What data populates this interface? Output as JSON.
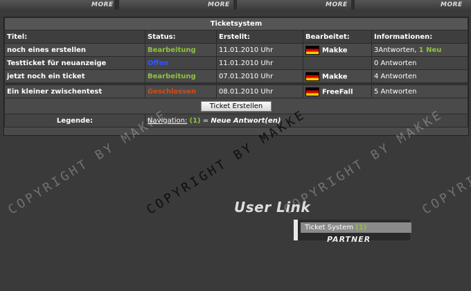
{
  "topbar": {
    "more_label": "MORE"
  },
  "table": {
    "title": "Ticketsystem",
    "headers": [
      "Titel:",
      "Status:",
      "Erstellt:",
      "Bearbeitet:",
      "Informationen:"
    ],
    "rows": [
      {
        "title": "noch eines erstellen",
        "status": "Bearbeitung",
        "created": "11.01.2010 Uhr",
        "editor": "Makke",
        "info": "3Antworten,",
        "info_new": "1 Neu"
      },
      {
        "title": "Testticket für neuanzeige",
        "status": "Offen",
        "created": "11.01.2010 Uhr",
        "editor": "",
        "info": "0 Antworten",
        "info_new": ""
      },
      {
        "title": "jetzt noch ein ticket",
        "status": "Bearbeitung",
        "created": "07.01.2010 Uhr",
        "editor": "Makke",
        "info": "4 Antworten",
        "info_new": ""
      },
      {
        "title": "Ein kleiner zwischentest",
        "status": "Geschlossen",
        "created": "08.01.2010 Uhr",
        "editor": "FreeFall",
        "info": "5 Antworten",
        "info_new": ""
      }
    ],
    "create_button": "Ticket Erstellen",
    "legend_label": "Legende:",
    "legend_nav": "Navigation:",
    "legend_count": "(1)",
    "legend_eq": " = ",
    "legend_new": "Neue Antwort(en)"
  },
  "watermark": "COPYRIGHT BY MAKKE",
  "userlink": {
    "title": "User Link",
    "item": "Ticket System",
    "item_count": "(1)",
    "partner": "PARTNER"
  },
  "colors": {
    "green": "#8fc33a",
    "blue": "#3355ff",
    "orange": "#d74b14"
  }
}
